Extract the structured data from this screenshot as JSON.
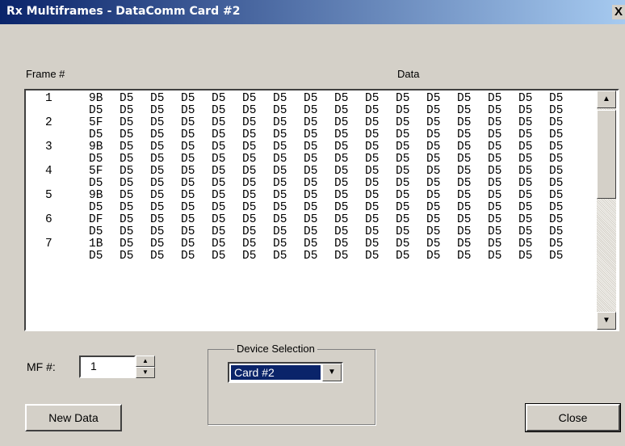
{
  "window": {
    "title": "Rx Multiframes - DataComm Card #2",
    "close_label": "X"
  },
  "labels": {
    "frame_header": "Frame #",
    "data_header": "Data"
  },
  "frames": [
    {
      "number": "1",
      "line1": [
        "9B",
        "D5",
        "D5",
        "D5",
        "D5",
        "D5",
        "D5",
        "D5",
        "D5",
        "D5",
        "D5",
        "D5",
        "D5",
        "D5",
        "D5",
        "D5"
      ],
      "line2": [
        "D5",
        "D5",
        "D5",
        "D5",
        "D5",
        "D5",
        "D5",
        "D5",
        "D5",
        "D5",
        "D5",
        "D5",
        "D5",
        "D5",
        "D5",
        "D5"
      ]
    },
    {
      "number": "2",
      "line1": [
        "5F",
        "D5",
        "D5",
        "D5",
        "D5",
        "D5",
        "D5",
        "D5",
        "D5",
        "D5",
        "D5",
        "D5",
        "D5",
        "D5",
        "D5",
        "D5"
      ],
      "line2": [
        "D5",
        "D5",
        "D5",
        "D5",
        "D5",
        "D5",
        "D5",
        "D5",
        "D5",
        "D5",
        "D5",
        "D5",
        "D5",
        "D5",
        "D5",
        "D5"
      ]
    },
    {
      "number": "3",
      "line1": [
        "9B",
        "D5",
        "D5",
        "D5",
        "D5",
        "D5",
        "D5",
        "D5",
        "D5",
        "D5",
        "D5",
        "D5",
        "D5",
        "D5",
        "D5",
        "D5"
      ],
      "line2": [
        "D5",
        "D5",
        "D5",
        "D5",
        "D5",
        "D5",
        "D5",
        "D5",
        "D5",
        "D5",
        "D5",
        "D5",
        "D5",
        "D5",
        "D5",
        "D5"
      ]
    },
    {
      "number": "4",
      "line1": [
        "5F",
        "D5",
        "D5",
        "D5",
        "D5",
        "D5",
        "D5",
        "D5",
        "D5",
        "D5",
        "D5",
        "D5",
        "D5",
        "D5",
        "D5",
        "D5"
      ],
      "line2": [
        "D5",
        "D5",
        "D5",
        "D5",
        "D5",
        "D5",
        "D5",
        "D5",
        "D5",
        "D5",
        "D5",
        "D5",
        "D5",
        "D5",
        "D5",
        "D5"
      ]
    },
    {
      "number": "5",
      "line1": [
        "9B",
        "D5",
        "D5",
        "D5",
        "D5",
        "D5",
        "D5",
        "D5",
        "D5",
        "D5",
        "D5",
        "D5",
        "D5",
        "D5",
        "D5",
        "D5"
      ],
      "line2": [
        "D5",
        "D5",
        "D5",
        "D5",
        "D5",
        "D5",
        "D5",
        "D5",
        "D5",
        "D5",
        "D5",
        "D5",
        "D5",
        "D5",
        "D5",
        "D5"
      ]
    },
    {
      "number": "6",
      "line1": [
        "DF",
        "D5",
        "D5",
        "D5",
        "D5",
        "D5",
        "D5",
        "D5",
        "D5",
        "D5",
        "D5",
        "D5",
        "D5",
        "D5",
        "D5",
        "D5"
      ],
      "line2": [
        "D5",
        "D5",
        "D5",
        "D5",
        "D5",
        "D5",
        "D5",
        "D5",
        "D5",
        "D5",
        "D5",
        "D5",
        "D5",
        "D5",
        "D5",
        "D5"
      ]
    },
    {
      "number": "7",
      "line1": [
        "1B",
        "D5",
        "D5",
        "D5",
        "D5",
        "D5",
        "D5",
        "D5",
        "D5",
        "D5",
        "D5",
        "D5",
        "D5",
        "D5",
        "D5",
        "D5"
      ],
      "line2": [
        "D5",
        "D5",
        "D5",
        "D5",
        "D5",
        "D5",
        "D5",
        "D5",
        "D5",
        "D5",
        "D5",
        "D5",
        "D5",
        "D5",
        "D5",
        "D5"
      ]
    }
  ],
  "mf": {
    "label": "MF #:",
    "value": "1"
  },
  "device": {
    "group_title": "Device Selection",
    "selected": "Card #2"
  },
  "buttons": {
    "new_data": "New Data",
    "close": "Close"
  },
  "colors": {
    "face": "#d4d0c8",
    "title_start": "#0a246a",
    "title_end": "#a6caf0",
    "selection": "#0a246a"
  }
}
